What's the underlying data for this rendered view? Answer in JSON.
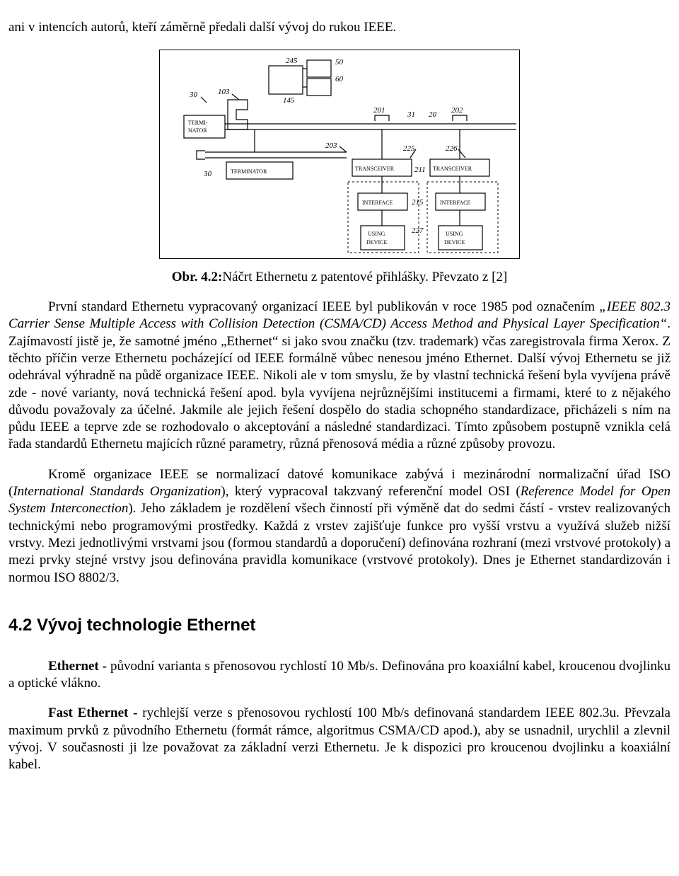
{
  "top_line": "ani v intencích autorů, kteří záměrně předali další vývoj do rukou IEEE.",
  "diagram": {
    "labels": {
      "n103": "103",
      "n30": "30",
      "n245": "245",
      "n50": "50",
      "n60": "60",
      "n145": "145",
      "n201": "201",
      "n31": "31",
      "n20": "20",
      "n202": "202",
      "n203": "203",
      "n225": "225",
      "n226": "226",
      "n211": "211",
      "n215": "215",
      "n227": "227",
      "termi_nator": "TERMI-\nNATOR",
      "terminator": "TERMINATOR",
      "transceiver1": "TRANSCEIVER",
      "transceiver2": "TRANSCEIVER",
      "interface1": "INTERFACE",
      "interface2": "INTERFACE",
      "using_device1": "USING\nDEVICE",
      "using_device2": "USING\nDEVICE"
    }
  },
  "caption": {
    "prefix": "Obr. 4.2:",
    "text": "Náčrt Ethernetu z patentové přihlášky. Převzato z [2]"
  },
  "paragraph1": {
    "p1a": "První standard Ethernetu vypracovaný organizací IEEE byl publikován v roce 1985 pod označením ",
    "p1b_italic": "„IEEE 802.3 Carrier Sense Multiple Access with Collision Detection (CSMA/CD) Access Method and Physical Layer Specification“",
    "p1c": ". Zajímavostí jistě je, že samotné jméno „Ethernet“ si jako svou značku (tzv. trademark) včas zaregistrovala firma Xerox. Z těchto příčin verze Ethernetu pocházející od IEEE formálně vůbec nenesou jméno Ethernet. Další vývoj Ethernetu se již odehrával výhradně na půdě organizace IEEE. Nikoli ale v tom smyslu, že by vlastní technická řešení byla vyvíjena právě zde - nové varianty, nová technická řešení apod. byla vyvíjena nejrůznějšími institucemi a firmami, které to z nějakého důvodu považovaly za účelné. Jakmile ale jejich řešení dospělo do stadia schopného standardizace, přicházeli s ním na půdu IEEE a teprve zde se rozhodovalo o akceptování a následné standardizaci. Tímto způsobem postupně vznikla celá řada standardů Ethernetu majících různé parametry, různá přenosová média a různé způsoby provozu."
  },
  "paragraph2": {
    "p2a": "Kromě organizace IEEE se normalizací datové komunikace zabývá i mezinárodní normalizační úřad ISO (",
    "p2b_italic": "International Standards Organization",
    "p2c": "), který vypracoval takzvaný referenční model OSI (",
    "p2d_italic": "Reference Model for Open System Interconection",
    "p2e": "). Jeho základem je rozdělení všech činností při výměně dat do sedmi částí - vrstev realizovaných technickými nebo programovými prostředky. Každá z vrstev zajišťuje funkce pro vyšší vrstvu a využívá služeb nižší vrstvy. Mezi jednotlivými vrstvami jsou (formou standardů a doporučení) definována rozhraní (mezi vrstvové protokoly) a mezi prvky stejné vrstvy jsou definována pravidla komunikace (vrstvové protokoly). Dnes je Ethernet standardizován i normou ISO 8802/3."
  },
  "section_title": "4.2 Vývoj technologie Ethernet",
  "paragraph3": {
    "p3a_bold": "Ethernet - ",
    "p3b": "původní varianta s přenosovou rychlostí 10 Mb/s. Definována pro koaxiální kabel, kroucenou dvojlinku a optické vlákno."
  },
  "paragraph4": {
    "p4a_bold": "Fast Ethernet - ",
    "p4b": "rychlejší verze s přenosovou rychlostí 100 Mb/s definovaná standardem IEEE 802.3u. Převzala maximum prvků z původního Ethernetu (formát rámce, algoritmus CSMA/CD apod.), aby se usnadnil, urychlil a zlevnil vývoj. V současnosti ji lze považovat za základní verzi Ethernetu. Je k dispozici pro kroucenou dvojlinku a koaxiální kabel."
  }
}
